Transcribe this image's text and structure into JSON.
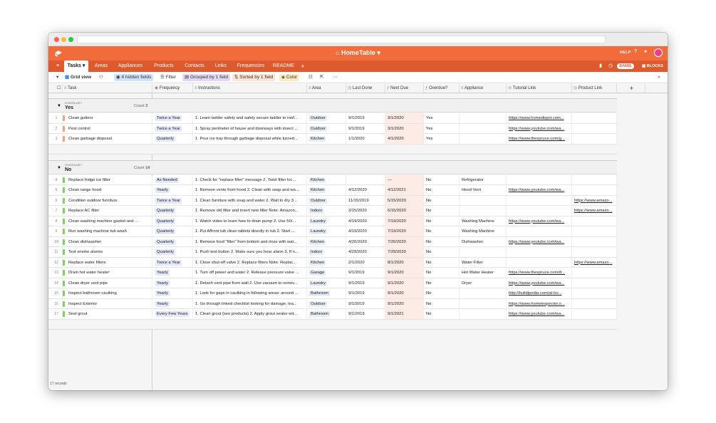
{
  "colors": {
    "accent": "#f26b3a",
    "tabbar": "#de5a2e",
    "yes_bar": "#f4a07a",
    "no_bar": "#7fd160"
  },
  "app": {
    "base_title": "HomeTable",
    "help": "HELP",
    "share": "SHARE",
    "blocks": "BLOCKS"
  },
  "tabs": [
    {
      "label": "Tasks"
    },
    {
      "label": "Areas"
    },
    {
      "label": "Appliances"
    },
    {
      "label": "Products"
    },
    {
      "label": "Contacts"
    },
    {
      "label": "Links"
    },
    {
      "label": "Frequencies"
    },
    {
      "label": "README"
    }
  ],
  "toolbar": {
    "view": "Grid view",
    "hidden": "4 hidden fields",
    "filter": "Filter",
    "group": "Grouped by 1 field",
    "sort": "Sorted by 1 field",
    "color": "Color"
  },
  "columns": [
    "Task",
    "Frequency",
    "Instructions",
    "Area",
    "Last Done",
    "Next Due",
    "Overdue?",
    "Appliance",
    "Tutorial Link",
    "Product Link"
  ],
  "groups": [
    {
      "label": "OVERDUE?",
      "value": "Yes",
      "count_label": "Count",
      "count": "3",
      "rows": [
        {
          "num": "1",
          "task": "Clean gutters",
          "freq": "Twice a Year",
          "instr": "1. Learn ladder safety and safely secure ladder to roof...",
          "area": "Outdoor",
          "last": "9/1/2019",
          "next": "3/1/2020",
          "over": "Yes",
          "appl": "",
          "tut": "https://www.homedepot.com...",
          "prod": ""
        },
        {
          "num": "2",
          "task": "Pest control",
          "freq": "Twice a Year",
          "instr": "1. Spray perimeter of house and doorways with insect ...",
          "area": "Outdoor",
          "last": "9/1/2019",
          "next": "3/1/2020",
          "over": "Yes",
          "appl": "",
          "tut": "https://www.youtube.com/wa...",
          "prod": ""
        },
        {
          "num": "3",
          "task": "Clean garbage disposal",
          "freq": "Quarterly",
          "instr": "1. Pour ice tray through garbage disposal while turned...",
          "area": "Kitchen",
          "last": "1/1/2020",
          "next": "4/1/2020",
          "over": "Yes",
          "appl": "",
          "tut": "https://www.thespruce.com/g...",
          "prod": ""
        }
      ]
    },
    {
      "label": "OVERDUE?",
      "value": "No",
      "count_label": "Count",
      "count": "14",
      "rows": [
        {
          "num": "4",
          "task": "Replace fridge ice filter",
          "freq": "As Needed",
          "instr": "1. Check for \"replace filter\" message 2. Twist filter loc...",
          "area": "Kitchen",
          "last": "",
          "next": "---",
          "over": "No",
          "appl": "Refrigerator",
          "tut": "",
          "prod": ""
        },
        {
          "num": "5",
          "task": "Clean range hood",
          "freq": "Yearly",
          "instr": "1. Remove vents from hood 2. Clean with soap and wa...",
          "area": "Kitchen",
          "last": "4/12/2020",
          "next": "4/12/2021",
          "over": "No",
          "appl": "Hood Vent",
          "tut": "https://www.youtube.com/wa...",
          "prod": ""
        },
        {
          "num": "6",
          "task": "Condition outdoor furniture",
          "freq": "Twice a Year",
          "instr": "1. Clean furniture with soap and water 2. Wait to dry 3...",
          "area": "Outdoor",
          "last": "11/15/2019",
          "next": "5/15/2020",
          "over": "No",
          "appl": "",
          "tut": "",
          "prod": "https://www.amazo..."
        },
        {
          "num": "7",
          "task": "Replace AC filter",
          "freq": "Quarterly",
          "instr": "1. Remove old filter and insert new filter Note: Amazon...",
          "area": "Indoor",
          "last": "3/15/2020",
          "next": "6/15/2020",
          "over": "No",
          "appl": "",
          "tut": "",
          "prod": "https://www.amazo..."
        },
        {
          "num": "8",
          "task": "Clean washing machine gasket and ...",
          "freq": "Quarterly",
          "instr": "1. Watch video to learn how to drain pump 2. Use 50/...",
          "area": "Laundry",
          "last": "4/19/2020",
          "next": "7/19/2020",
          "over": "No",
          "appl": "Washing Machine",
          "tut": "https://www.youtube.com/wa...",
          "prod": ""
        },
        {
          "num": "9",
          "task": "Run washing machine tub wash",
          "freq": "Quarterly",
          "instr": "1. Put Affront tub clean tablets directly in tub 2. Start ...",
          "area": "Laundry",
          "last": "4/19/2020",
          "next": "7/19/2020",
          "over": "No",
          "appl": "Washing Machine",
          "tut": "",
          "prod": ""
        },
        {
          "num": "10",
          "task": "Clean dishwasher",
          "freq": "Quarterly",
          "instr": "1. Remove food \"filter\" from bottom and rinse with wat...",
          "area": "Kitchen",
          "last": "4/20/2020",
          "next": "7/20/2020",
          "over": "No",
          "appl": "Dishwasher",
          "tut": "https://www.youtube.com/wa...",
          "prod": ""
        },
        {
          "num": "11",
          "task": "Test smoke alarms",
          "freq": "Quarterly",
          "instr": "1. Push test button 2. Make sure you hear alarm 3. If n...",
          "area": "Indoor",
          "last": "4/29/2020",
          "next": "7/29/2020",
          "over": "No",
          "appl": "",
          "tut": "",
          "prod": ""
        },
        {
          "num": "12",
          "task": "Replace water filters",
          "freq": "Twice a Year",
          "instr": "1. Close shut-off valve 2. Replace filters Note: Replac...",
          "area": "Kitchen",
          "last": "2/1/2020",
          "next": "8/1/2020",
          "over": "No",
          "appl": "Water Filter",
          "tut": "",
          "prod": "https://www.amazo..."
        },
        {
          "num": "13",
          "task": "Drain hot water heater",
          "freq": "Yearly",
          "instr": "1. Turn off power and water 2. Release pressure valve ...",
          "area": "Garage",
          "last": "9/1/2019",
          "next": "9/1/2020",
          "over": "No",
          "appl": "Hot Water Heater",
          "tut": "https://www.thespruce.com/d...",
          "prod": ""
        },
        {
          "num": "14",
          "task": "Clean dryer vent pipe",
          "freq": "Yearly",
          "instr": "1. Detach vent pipe from wall 2. Use vacuum to remov...",
          "area": "Laundry",
          "last": "9/1/2019",
          "next": "9/1/2020",
          "over": "No",
          "appl": "Dryer",
          "tut": "https://www.youtube.com/wa...",
          "prod": ""
        },
        {
          "num": "15",
          "task": "Inspect bathroom caulking",
          "freq": "Yearly",
          "instr": "1. Look for gaps in caulking in following areas: around ...",
          "area": "Bathroom",
          "last": "9/1/2019",
          "next": "9/1/2020",
          "over": "No",
          "appl": "",
          "tut": "http://buildipedia.com/at-ho...",
          "prod": ""
        },
        {
          "num": "16",
          "task": "Inspect Exterior",
          "freq": "Yearly",
          "instr": "1. Go through linked checklist looking for damage, lea...",
          "area": "Outdoor",
          "last": "9/1/2019",
          "next": "9/1/2020",
          "over": "No",
          "appl": "",
          "tut": "https://www.homeinspector.o...",
          "prod": ""
        },
        {
          "num": "17",
          "task": "Seal grout",
          "freq": "Every Few Years",
          "instr": "1. Clean grout (see products) 2. Apply grout sealer wit...",
          "area": "Bathroom",
          "last": "9/1/2019",
          "next": "9/1/2021",
          "over": "No",
          "appl": "",
          "tut": "https://www.youtube.com/wa...",
          "prod": ""
        }
      ]
    }
  ],
  "footer": "17 records"
}
